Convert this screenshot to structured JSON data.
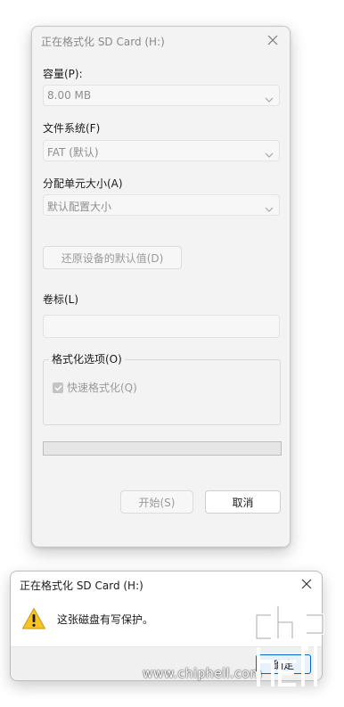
{
  "format_dialog": {
    "title": "正在格式化 SD Card (H:)",
    "capacity": {
      "label": "容量(P):",
      "value": "8.00 MB"
    },
    "filesystem": {
      "label": "文件系统(F)",
      "value": "FAT (默认)"
    },
    "allocation": {
      "label": "分配单元大小(A)",
      "value": "默认配置大小"
    },
    "restore_defaults_label": "还原设备的默认值(D)",
    "volume_label": {
      "label": "卷标(L)",
      "value": ""
    },
    "options": {
      "legend": "格式化选项(O)",
      "quick_format_label": "快速格式化(Q)",
      "quick_format_checked": true
    },
    "progress_percent": 0,
    "start_label": "开始(S)",
    "cancel_label": "取消"
  },
  "message_box": {
    "title": "正在格式化 SD Card (H:)",
    "message": "这张磁盘有写保护。",
    "ok_label": "确定",
    "icon": "warning-icon"
  },
  "watermark": {
    "text": "www.chiphell.com",
    "logo_text": "chiphell"
  },
  "colors": {
    "accent": "#0067c0",
    "warning_fill": "#f7c325",
    "progress_fill": "#06b025"
  }
}
